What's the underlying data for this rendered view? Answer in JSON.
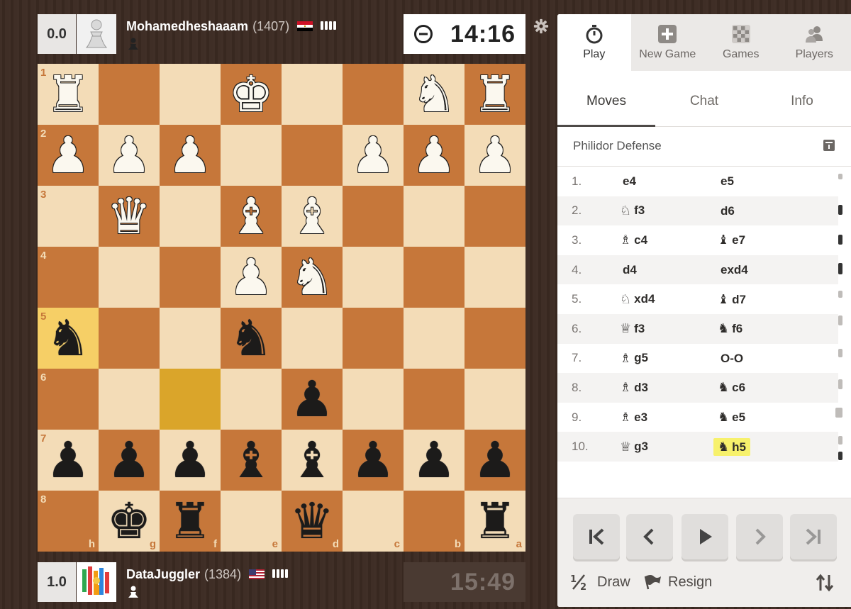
{
  "top_player": {
    "score": "0.0",
    "name": "Mohamedheshaaam",
    "rating": "(1407)",
    "flag": "egypt",
    "clock": "14:16"
  },
  "bottom_player": {
    "score": "1.0",
    "name": "DataJuggler",
    "rating": "(1384)",
    "flag": "usa",
    "clock": "15:49"
  },
  "board": {
    "rank_labels": [
      "1",
      "2",
      "3",
      "4",
      "5",
      "6",
      "7",
      "8"
    ],
    "file_labels": [
      "h",
      "g",
      "f",
      "e",
      "d",
      "c",
      "b",
      "a"
    ],
    "rows": [
      [
        "wR",
        "",
        "",
        "wK",
        "",
        "",
        "wN",
        "wR"
      ],
      [
        "wP",
        "wP",
        "wP",
        "",
        "",
        "wP",
        "wP",
        "wP"
      ],
      [
        "",
        "wQ",
        "",
        "wB",
        "wB",
        "",
        "",
        ""
      ],
      [
        "",
        "",
        "",
        "wP",
        "wN",
        "",
        "",
        ""
      ],
      [
        "bN",
        "",
        "",
        "bN",
        "",
        "",
        "",
        ""
      ],
      [
        "",
        "",
        "",
        "",
        "bP",
        "",
        "",
        ""
      ],
      [
        "bP",
        "bP",
        "bP",
        "bB",
        "bB",
        "bP",
        "bP",
        "bP"
      ],
      [
        "",
        "bK",
        "bR",
        "",
        "bQ",
        "",
        "",
        "bR"
      ]
    ],
    "last_move_squares": [
      "h5",
      "f6"
    ]
  },
  "tabs": {
    "main": [
      {
        "label": "Play",
        "icon": "stopwatch-icon"
      },
      {
        "label": "New Game",
        "icon": "plus-icon"
      },
      {
        "label": "Games",
        "icon": "board-icon"
      },
      {
        "label": "Players",
        "icon": "players-icon"
      }
    ],
    "sub": [
      "Moves",
      "Chat",
      "Info"
    ]
  },
  "opening": "Philidor Defense",
  "moves": [
    {
      "num": "1.",
      "white": {
        "fig": "",
        "san": "e4"
      },
      "black": {
        "fig": "",
        "san": "e5"
      }
    },
    {
      "num": "2.",
      "white": {
        "fig": "♘",
        "san": "f3"
      },
      "black": {
        "fig": "",
        "san": "d6"
      }
    },
    {
      "num": "3.",
      "white": {
        "fig": "♗",
        "san": "c4"
      },
      "black": {
        "fig": "♝",
        "san": "e7"
      }
    },
    {
      "num": "4.",
      "white": {
        "fig": "",
        "san": "d4"
      },
      "black": {
        "fig": "",
        "san": "exd4"
      }
    },
    {
      "num": "5.",
      "white": {
        "fig": "♘",
        "san": "xd4"
      },
      "black": {
        "fig": "♝",
        "san": "d7"
      }
    },
    {
      "num": "6.",
      "white": {
        "fig": "♕",
        "san": "f3"
      },
      "black": {
        "fig": "♞",
        "san": "f6"
      }
    },
    {
      "num": "7.",
      "white": {
        "fig": "♗",
        "san": "g5"
      },
      "black": {
        "fig": "",
        "san": "O-O"
      }
    },
    {
      "num": "8.",
      "white": {
        "fig": "♗",
        "san": "d3"
      },
      "black": {
        "fig": "♞",
        "san": "c6"
      }
    },
    {
      "num": "9.",
      "white": {
        "fig": "♗",
        "san": "e3"
      },
      "black": {
        "fig": "♞",
        "san": "e5"
      }
    },
    {
      "num": "10.",
      "white": {
        "fig": "♕",
        "san": "g3"
      },
      "black": {
        "fig": "♞",
        "san": "h5",
        "current": true
      }
    }
  ],
  "actions": {
    "draw_label": "Draw",
    "resign_label": "Resign"
  },
  "colors": {
    "light_square": "#f3dcb7",
    "dark_square": "#c6773a",
    "highlight": "#f6cf66",
    "current_move": "#f7f16c"
  }
}
